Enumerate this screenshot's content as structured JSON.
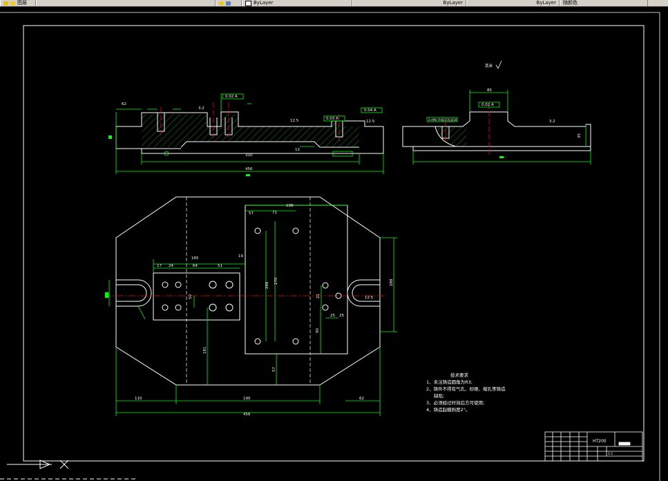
{
  "taskbar": {
    "items": [
      {
        "label": "图层",
        "icon": "folder-icon"
      },
      {
        "label": "",
        "icon": "lightbulb-icon"
      },
      {
        "label": "ByLayer",
        "icon": "color-swatch-icon"
      },
      {
        "label": "ByLayer",
        "icon": "linetype-icon"
      },
      {
        "label": "ByLayer",
        "icon": "lineweight-icon"
      },
      {
        "label": "随颜色",
        "icon": "plotstyle-icon"
      }
    ]
  },
  "drawing": {
    "top_view": {
      "dims": [
        "62",
        "3.2",
        "12.5",
        "12.5",
        "310",
        "12",
        "456"
      ],
      "gdt": [
        "0.02 A",
        "0.03 A",
        "0.04 A"
      ]
    },
    "side_view": {
      "dims": [
        "85",
        "3.2",
        "35"
      ],
      "gdt": [
        "0.02 A"
      ],
      "note": "2×M8-7H深15孔深18"
    },
    "roughness_note": "其余",
    "plan_view": {
      "dims": [
        "198",
        "57",
        "71",
        "165",
        "19",
        "17",
        "24",
        "64",
        "51",
        "50",
        "266",
        "270",
        "21",
        "25",
        "25",
        "90",
        "40",
        "12.5",
        "181",
        "57",
        "110",
        "190",
        "62",
        "456",
        "288"
      ]
    },
    "tech_requirements": {
      "title": "技术要求",
      "lines": [
        "1、未注铸造圆角为R3;",
        "2、铸件不得有气孔、砂眼、缩孔等铸造",
        "缺陷;",
        "3、必须经过时效后方可使用;",
        "4、铸造起模斜度2°。"
      ]
    },
    "title_block": {
      "material": "HT200",
      "scale": "1:1"
    }
  },
  "colors": {
    "background": "#000000",
    "outline": "#ffffff",
    "dimension": "#00ff00",
    "centerline": "#ff0000",
    "hatch": "#00cc00",
    "text": "#ffffff"
  }
}
